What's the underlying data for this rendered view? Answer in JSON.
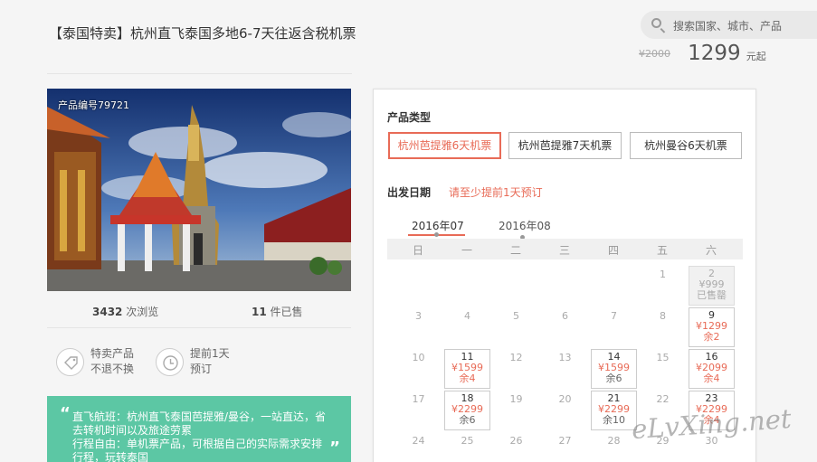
{
  "product": {
    "title": "【泰国特卖】杭州直飞泰国多地6-7天往返含税机票",
    "code_label": "产品编号79721",
    "original_price": "¥2000",
    "price": "1299",
    "price_unit": "元起"
  },
  "search": {
    "placeholder": "搜索国家、城市、产品"
  },
  "stats": {
    "views": "3432",
    "views_label": "次浏览",
    "sold": "11",
    "sold_label": "件已售"
  },
  "features": [
    {
      "icon": "tag-icon",
      "line1": "特卖产品",
      "line2": "不退不换"
    },
    {
      "icon": "clock-icon",
      "line1": "提前1天",
      "line2": "预订"
    }
  ],
  "notice": {
    "line1": "直飞航班：杭州直飞泰国芭提雅/曼谷，一站直达，省",
    "line2": "去转机时间以及旅途劳累",
    "line3": "行程自由：单机票产品，可根据自己的实际需求安排",
    "line4": "行程，玩转泰国"
  },
  "booking": {
    "type_label": "产品类型",
    "types": [
      "杭州芭提雅6天机票",
      "杭州芭提雅7天机票",
      "杭州曼谷6天机票"
    ],
    "selected_type": 0,
    "date_label": "出发日期",
    "date_hint": "请至少提前1天预订",
    "months": [
      "2016年07",
      "2016年08"
    ],
    "selected_month": 0,
    "weekdays": [
      "日",
      "一",
      "二",
      "三",
      "四",
      "五",
      "六"
    ]
  },
  "calendar": {
    "plain_days": [
      "1",
      "3",
      "4",
      "5",
      "6",
      "7",
      "8",
      "10",
      "12",
      "13",
      "15",
      "17",
      "19",
      "20",
      "22",
      "24",
      "25",
      "26",
      "27",
      "28",
      "29",
      "30"
    ],
    "available": [
      {
        "day": "2",
        "price": "¥999",
        "left": "已售罄",
        "sold_out": true
      },
      {
        "day": "9",
        "price": "¥1299",
        "left": "余2"
      },
      {
        "day": "11",
        "price": "¥1599",
        "left": "余4"
      },
      {
        "day": "14",
        "price": "¥1599",
        "left": "余6"
      },
      {
        "day": "16",
        "price": "¥2099",
        "left": "余4"
      },
      {
        "day": "18",
        "price": "¥2299",
        "left": "余6"
      },
      {
        "day": "21",
        "price": "¥2299",
        "left": "余10"
      },
      {
        "day": "23",
        "price": "¥2299",
        "left": "余4"
      }
    ]
  },
  "watermark": "eLvXing.net",
  "colors": {
    "accent": "#e86b57",
    "notice_bg": "#5cc7a4"
  }
}
